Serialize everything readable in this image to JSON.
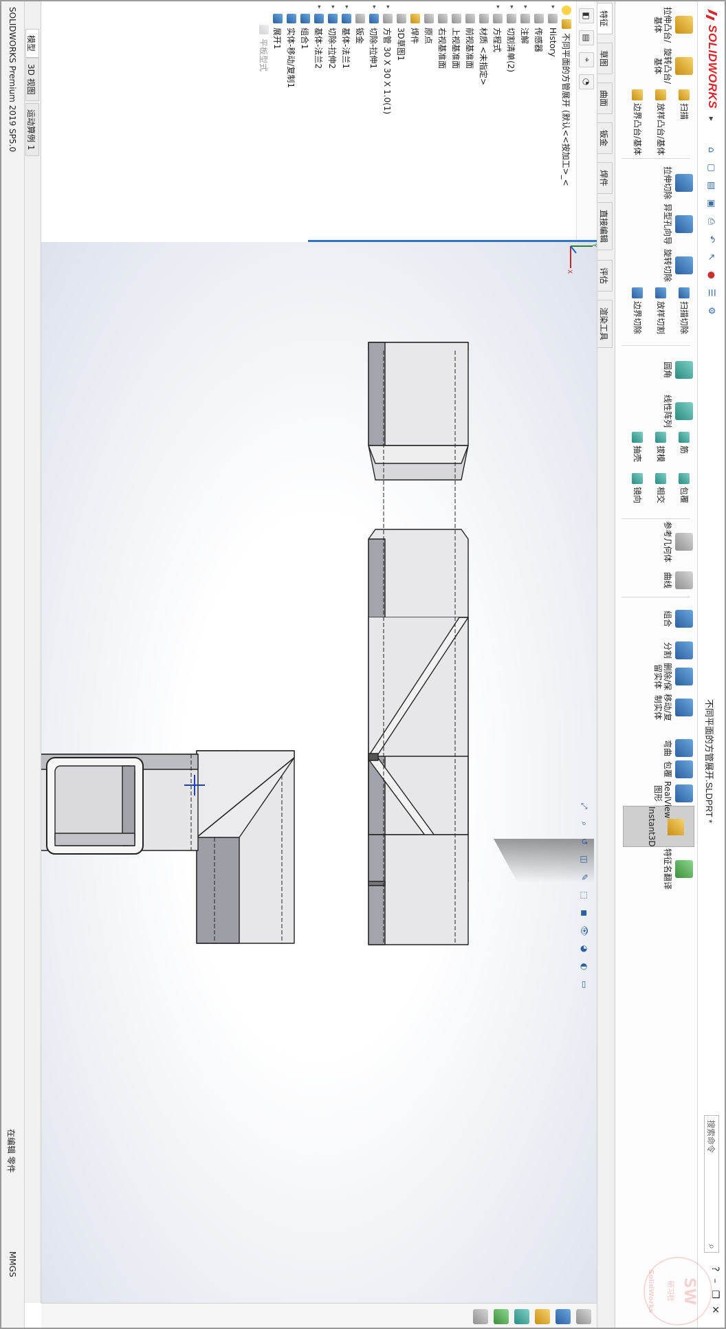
{
  "app": {
    "brand": "SOLIDWORKS",
    "document_title": "不同平面的方管展开.SLDPRT *",
    "search_placeholder": "搜索命令",
    "product_status": "SOLIDWORKS Premium 2019 SP5.0"
  },
  "commands": {
    "extrude_boss": "拉伸凸台/基体",
    "revolve_boss": "旋转凸台/基体",
    "sweep": "扫描",
    "loft_boss": "放样凸台/基体",
    "boundary_boss": "边界凸台/基体",
    "extrude_cut": "拉伸切除",
    "hole_wizard": "异型孔向导",
    "revolve_cut": "旋转切除",
    "sweep_cut": "扫描切除",
    "loft_cut": "放样切割",
    "boundary_cut": "边界切除",
    "fillet": "圆角",
    "linear_pattern": "线性阵列",
    "rib": "筋",
    "draft": "拔模",
    "shell": "抽壳",
    "wrap": "包覆",
    "intersect": "相交",
    "mirror": "镜向",
    "ref_geometry": "参考几何体",
    "curves": "曲线",
    "combine": "组合",
    "split": "分割",
    "delete_keep_body": "删除/保留实体",
    "move_copy_body": "移动/复制实体",
    "flex": "弯曲",
    "indent": "包覆",
    "realview": "RealView 图形",
    "instant3d": "Instant3D",
    "feature_rename": "特征名翻译"
  },
  "tabs": [
    "特征",
    "草图",
    "曲面",
    "钣金",
    "焊件",
    "直接编辑",
    "评估",
    "渲染工具"
  ],
  "tree": {
    "root": "不同平面的方管展开 (默认<<按加工>_<",
    "items": [
      "History",
      "传感器",
      "注解",
      "切割清单(2)",
      "方程式",
      "材质 <未指定>",
      "前视基准面",
      "上视基准面",
      "右视基准面",
      "原点",
      "焊件",
      "3D草图1",
      "方管 30 X 30 X 1.0(1)",
      "切除-拉伸1",
      "钣金",
      "基体-法兰1",
      "切除-拉伸2",
      "基体-法兰2",
      "组合1",
      "实体-移动/复制1",
      "展开1"
    ],
    "ghost_item": "平板型式"
  },
  "model_tabs": [
    "模型",
    "3D 视图",
    "运动算例 1"
  ],
  "status": {
    "editing": "在编辑 零件",
    "units": "MMGS"
  },
  "triad": {
    "x": "X",
    "y": "Y"
  },
  "watermark": {
    "big": "SW",
    "small": "研习社",
    "tiny": "SolidWorks"
  },
  "colors": {
    "brand_red": "#d9262b",
    "accent_blue": "#2e74c9",
    "tube_face": "#e6e6e8",
    "tube_dark": "#9c9ca4"
  }
}
